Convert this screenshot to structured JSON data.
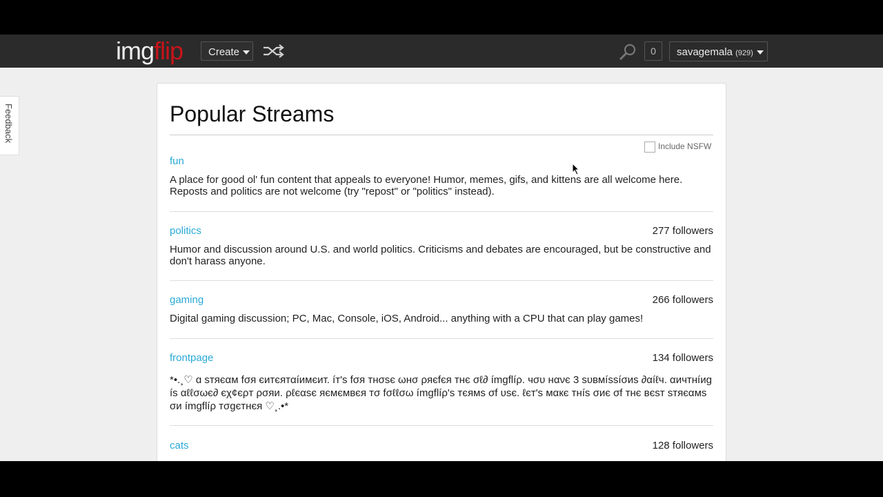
{
  "header": {
    "logo_part1": "img",
    "logo_part2": "flip",
    "create_label": "Create",
    "notifications": "0",
    "username": "savagemala",
    "points": "(929)"
  },
  "feedback_label": "Feedback",
  "page": {
    "title": "Popular Streams",
    "nsfw_label": "Include NSFW"
  },
  "streams": [
    {
      "name": "fun",
      "followers": "",
      "description": "A place for good ol' fun content that appeals to everyone! Humor, memes, gifs, and kittens are all welcome here. Reposts and politics are not welcome (try \"repost\" or \"politics\" instead)."
    },
    {
      "name": "politics",
      "followers": "277 followers",
      "description": "Humor and discussion around U.S. and world politics. Criticisms and debates are encouraged, but be constructive and don't harass anyone."
    },
    {
      "name": "gaming",
      "followers": "266 followers",
      "description": "Digital gaming discussion; PC, Mac, Console, iOS, Android... anything with a CPU that can play games!"
    },
    {
      "name": "frontpage",
      "followers": "134 followers",
      "description": "*•.¸♡ ɑ sтяєαм fσя єитєятαíимєит. íт's fσя тнσѕє ωнσ ρяєfєя тнє σℓ∂ ímgflíρ. чσυ нανє 3 ѕυвмíѕѕíσиѕ ∂αíℓч. αичтнíиg íѕ αℓℓσωє∂ єχ¢єρт ρσяи. ρℓєαѕє яємємвєя тσ fσℓℓσω ímgflíρ's тєямѕ σf υѕє. ℓєт's мαкє тнíѕ σиє σf тнє вєѕт ѕтяєαмѕ σи ímgflíρ тσgєтнєя ♡¸.•*"
    },
    {
      "name": "cats",
      "followers": "128 followers",
      "description": ""
    }
  ]
}
